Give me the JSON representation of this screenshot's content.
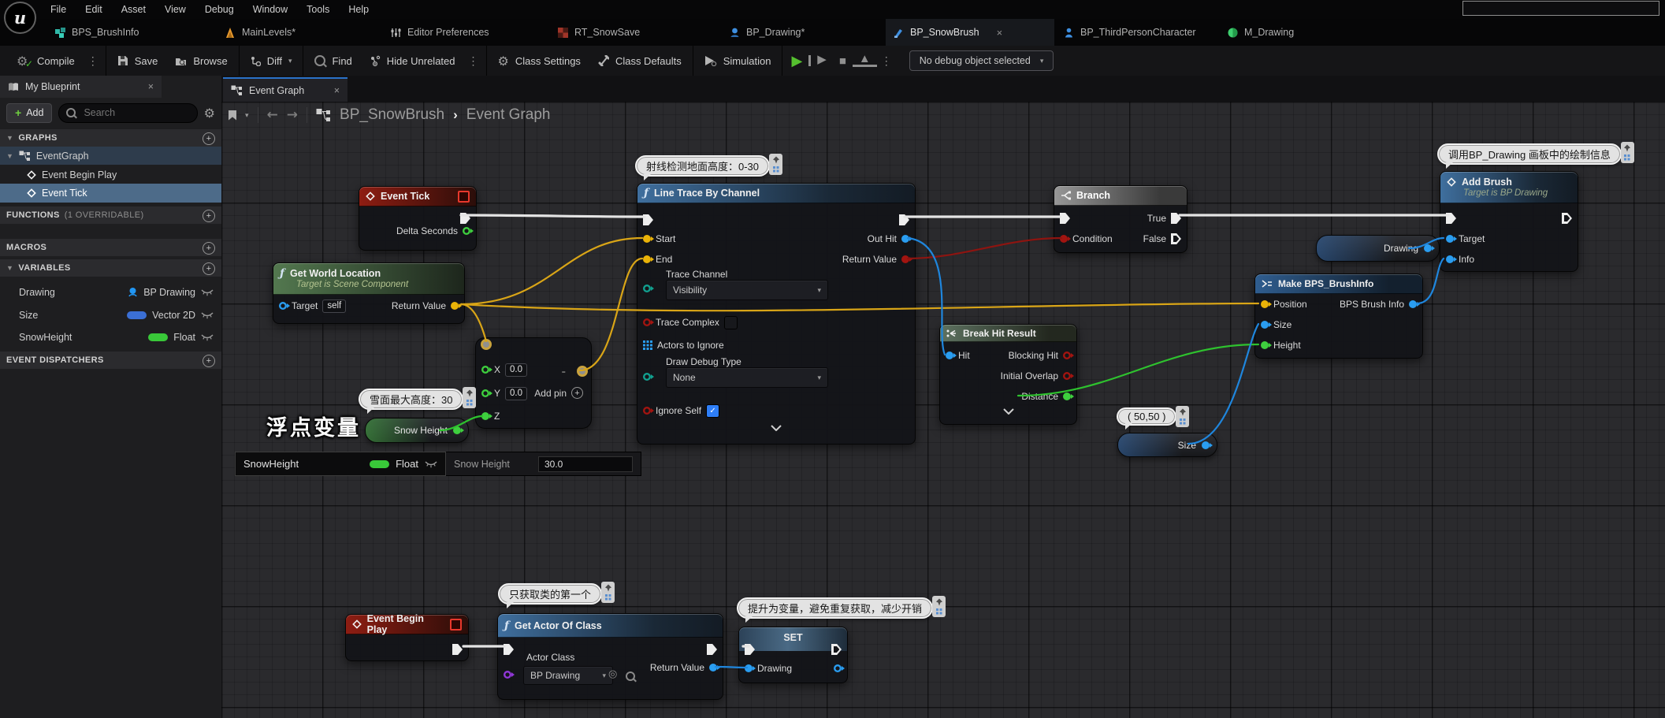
{
  "menubar": {
    "items": [
      "File",
      "Edit",
      "Asset",
      "View",
      "Debug",
      "Window",
      "Tools",
      "Help"
    ]
  },
  "asset_tabs": [
    {
      "label": "BPS_BrushInfo"
    },
    {
      "label": "MainLevels*"
    },
    {
      "label": "Editor Preferences"
    },
    {
      "label": "RT_SnowSave"
    },
    {
      "label": "BP_Drawing*"
    },
    {
      "label": "BP_SnowBrush"
    },
    {
      "label": "BP_ThirdPersonCharacter"
    },
    {
      "label": "M_Drawing"
    }
  ],
  "toolbar": {
    "compile": "Compile",
    "save": "Save",
    "browse": "Browse",
    "diff": "Diff",
    "find": "Find",
    "hide_unrelated": "Hide Unrelated",
    "class_settings": "Class Settings",
    "class_defaults": "Class Defaults",
    "simulation": "Simulation",
    "debug_object": "No debug object selected"
  },
  "sidebar": {
    "title": "My Blueprint",
    "add": "Add",
    "search_placeholder": "Search",
    "graphs_label": "GRAPHS",
    "event_graph": "EventGraph",
    "event_begin_play": "Event Begin Play",
    "event_tick": "Event Tick",
    "functions_label": "FUNCTIONS",
    "functions_count": "(1 OVERRIDABLE)",
    "macros_label": "MACROS",
    "variables_label": "VARIABLES",
    "dispatchers_label": "EVENT DISPATCHERS",
    "variables": [
      {
        "name": "Drawing",
        "type": "BP Drawing"
      },
      {
        "name": "Size",
        "type": "Vector 2D"
      },
      {
        "name": "SnowHeight",
        "type": "Float"
      }
    ]
  },
  "graph": {
    "tab": "Event Graph",
    "breadcrumb_root": "BP_SnowBrush",
    "breadcrumb_leaf": "Event Graph"
  },
  "nodes": {
    "event_tick": {
      "title": "Event Tick",
      "delta": "Delta Seconds"
    },
    "gwl": {
      "title": "Get World Location",
      "subtitle": "Target is Scene Component",
      "target": "Target",
      "self_value": "self",
      "ret": "Return Value"
    },
    "subtract": {
      "x": "X",
      "y": "Y",
      "z": "Z",
      "x_value": "0.0",
      "y_value": "0.0",
      "add_pin": "Add pin",
      "operator": "-"
    },
    "snow_get": {
      "label": "Snow Height"
    },
    "line_trace": {
      "title": "Line Trace By Channel",
      "start": "Start",
      "end": "End",
      "out_hit": "Out Hit",
      "ret": "Return Value",
      "trace_channel": "Trace Channel",
      "trace_channel_value": "Visibility",
      "trace_complex": "Trace Complex",
      "actors": "Actors to Ignore",
      "draw_debug": "Draw Debug Type",
      "draw_debug_value": "None",
      "ignore_self": "Ignore Self"
    },
    "branch": {
      "title": "Branch",
      "condition": "Condition",
      "true_label": "True",
      "false_label": "False"
    },
    "break_hit": {
      "title": "Break Hit Result",
      "hit": "Hit",
      "blocking": "Blocking Hit",
      "initial": "Initial Overlap",
      "distance": "Distance"
    },
    "size_get": {
      "label": "Size"
    },
    "make": {
      "title": "Make BPS_BrushInfo",
      "position": "Position",
      "size": "Size",
      "height": "Height",
      "out": "BPS Brush Info"
    },
    "drawing_get": {
      "label": "Drawing"
    },
    "add_brush": {
      "title": "Add Brush",
      "subtitle": "Target is BP Drawing",
      "target": "Target",
      "info": "Info"
    },
    "begin_play": {
      "title": "Event Begin Play"
    },
    "get_actor": {
      "title": "Get Actor Of Class",
      "actor_class": "Actor Class",
      "actor_class_value": "BP Drawing",
      "ret": "Return Value"
    },
    "set_node": {
      "title": "SET",
      "pin": "Drawing"
    }
  },
  "comments": {
    "trace": "射线检测地面高度：0-30",
    "snow_max": "雪面最大高度：30",
    "float_var": "浮点变量",
    "size": "( 50,50 )",
    "add_brush": "调用BP_Drawing 画板中的绘制信息",
    "first": "只获取类的第一个",
    "promote": "提升为变量，避免重复获取，减少开销"
  },
  "details": {
    "name": "SnowHeight",
    "type": "Float",
    "label": "Snow Height",
    "value": "30.0"
  },
  "colors": {
    "exec": "#e4e4e4",
    "vector": "#eab308",
    "object": "#2a9df0",
    "bool": "#a21410",
    "float": "#3ecf3e",
    "struct": "#11a08f",
    "class": "#9137d8",
    "accent_tab": "#2a72c8"
  }
}
